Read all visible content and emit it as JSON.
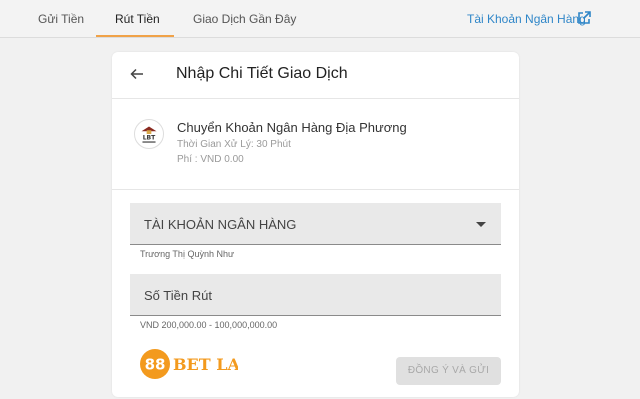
{
  "tabs": [
    {
      "label": "Gửi Tiền"
    },
    {
      "label": "Rút Tiền",
      "active": true
    },
    {
      "label": "Giao Dịch Gần Đây"
    }
  ],
  "bank_account_link": "Tài Khoản Ngân Hàng",
  "colors": {
    "accent": "#f0a248",
    "link": "#2f86c8",
    "brand_orange": "#f39a1e"
  },
  "card": {
    "title": "Nhập Chi Tiết Giao Dịch",
    "method": {
      "logo_icon": "lbt-bank-logo",
      "name": "Chuyển Khoản Ngân Hàng Địa Phương",
      "processing_time": "Thời Gian Xử Lý: 30 Phút",
      "fee": "Phí : VND 0.00"
    },
    "bank_select": {
      "label": "TÀI KHOẢN NGÂN HÀNG",
      "helper": "Trương Thị Quỳnh Như"
    },
    "amount": {
      "placeholder": "Số Tiền Rút",
      "helper": "VND 200,000.00 - 100,000,000.00"
    },
    "submit_label": "ĐỒNG Ý VÀ GỬI"
  },
  "brand": {
    "number": "88",
    "text": "BET LA"
  }
}
